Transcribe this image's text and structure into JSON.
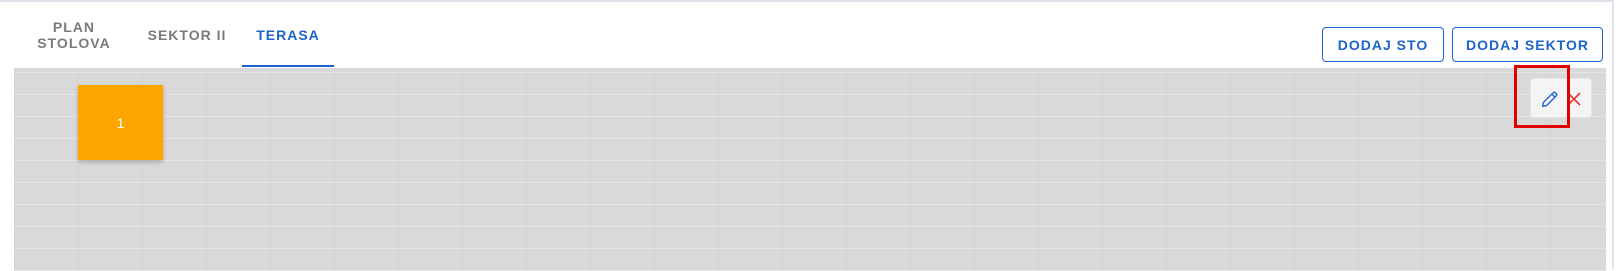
{
  "tabs": [
    {
      "label": "PLAN\nSTOLOVA",
      "active": false
    },
    {
      "label": "SEKTOR II",
      "active": false
    },
    {
      "label": "TERASA",
      "active": true
    }
  ],
  "toolbar": {
    "add_table_label": "DODAJ STO",
    "add_sector_label": "DODAJ SEKTOR"
  },
  "tables": [
    {
      "label": "1",
      "color": "#ffa500"
    }
  ],
  "actions": {
    "edit_icon": "pencil-icon",
    "delete_icon": "close-icon"
  },
  "colors": {
    "accent": "#1e63c9",
    "delete": "#e53935",
    "highlight": "#e00000"
  }
}
